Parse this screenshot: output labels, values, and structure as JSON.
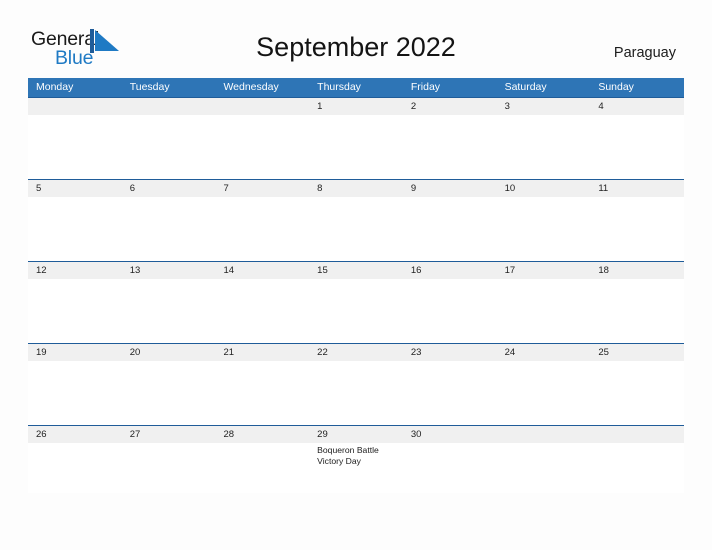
{
  "brand": {
    "name_top": "General",
    "name_bottom": "Blue",
    "mark_icon": "blue-triangle-logo-icon",
    "color_top": "#1a1a1a",
    "color_bottom": "#1f7ac4"
  },
  "header": {
    "title": "September 2022",
    "country": "Paraguay"
  },
  "calendar": {
    "month": "September",
    "year": "2022",
    "accent_color": "#2e75b6",
    "row_band_color": "#f0f0f0",
    "row_rule_color": "#1f5c99",
    "weekdays": [
      "Monday",
      "Tuesday",
      "Wednesday",
      "Thursday",
      "Friday",
      "Saturday",
      "Sunday"
    ],
    "weeks": [
      {
        "days": [
          {
            "num": "",
            "events": []
          },
          {
            "num": "",
            "events": []
          },
          {
            "num": "",
            "events": []
          },
          {
            "num": "1",
            "events": []
          },
          {
            "num": "2",
            "events": []
          },
          {
            "num": "3",
            "events": []
          },
          {
            "num": "4",
            "events": []
          }
        ]
      },
      {
        "days": [
          {
            "num": "5",
            "events": []
          },
          {
            "num": "6",
            "events": []
          },
          {
            "num": "7",
            "events": []
          },
          {
            "num": "8",
            "events": []
          },
          {
            "num": "9",
            "events": []
          },
          {
            "num": "10",
            "events": []
          },
          {
            "num": "11",
            "events": []
          }
        ]
      },
      {
        "days": [
          {
            "num": "12",
            "events": []
          },
          {
            "num": "13",
            "events": []
          },
          {
            "num": "14",
            "events": []
          },
          {
            "num": "15",
            "events": []
          },
          {
            "num": "16",
            "events": []
          },
          {
            "num": "17",
            "events": []
          },
          {
            "num": "18",
            "events": []
          }
        ]
      },
      {
        "days": [
          {
            "num": "19",
            "events": []
          },
          {
            "num": "20",
            "events": []
          },
          {
            "num": "21",
            "events": []
          },
          {
            "num": "22",
            "events": []
          },
          {
            "num": "23",
            "events": []
          },
          {
            "num": "24",
            "events": []
          },
          {
            "num": "25",
            "events": []
          }
        ]
      },
      {
        "days": [
          {
            "num": "26",
            "events": []
          },
          {
            "num": "27",
            "events": []
          },
          {
            "num": "28",
            "events": []
          },
          {
            "num": "29",
            "events": [
              "Boqueron Battle",
              "Victory Day"
            ]
          },
          {
            "num": "30",
            "events": []
          },
          {
            "num": "",
            "events": []
          },
          {
            "num": "",
            "events": []
          }
        ]
      }
    ]
  }
}
